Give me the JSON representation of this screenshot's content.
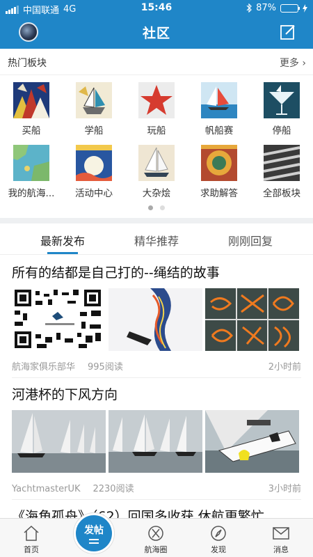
{
  "status": {
    "carrier": "中国联通",
    "network": "4G",
    "time": "15:46",
    "battery": "87%",
    "battery_level": 0.87
  },
  "header": {
    "title": "社区"
  },
  "hot": {
    "title": "热门板块",
    "more": "更多",
    "items": [
      {
        "label": "买船"
      },
      {
        "label": "学船"
      },
      {
        "label": "玩船"
      },
      {
        "label": "帆船赛"
      },
      {
        "label": "停船"
      },
      {
        "label": "我的航海..."
      },
      {
        "label": "活动中心"
      },
      {
        "label": "大杂烩"
      },
      {
        "label": "求助解答"
      },
      {
        "label": "全部板块"
      }
    ]
  },
  "tabs": [
    {
      "label": "最新发布"
    },
    {
      "label": "精华推荐"
    },
    {
      "label": "刚刚回复"
    }
  ],
  "posts": [
    {
      "title": "所有的结都是自己打的--绳结的故事",
      "author": "航海家俱乐部华",
      "reads": "995阅读",
      "time": "2小时前"
    },
    {
      "title": "河港杯的下风方向",
      "author": "YachtmasterUK",
      "reads": "2230阅读",
      "time": "3小时前"
    },
    {
      "title": "《海角孤舟》（62）回国多收获 休航更繁忙"
    }
  ],
  "tabbar": {
    "items": [
      {
        "label": "首页"
      },
      {
        "label": "航海圈"
      },
      {
        "label": "发现"
      },
      {
        "label": "消息"
      }
    ],
    "post_button": "发帖"
  },
  "colors": {
    "accent": "#1f86c8",
    "background": "#ffffff"
  }
}
